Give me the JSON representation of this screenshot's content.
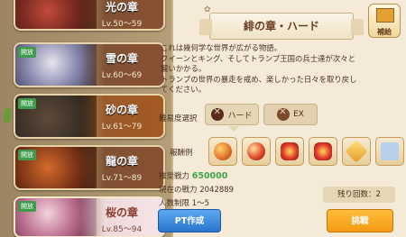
{
  "chapters": [
    {
      "name": "光の章",
      "level": "Lv.50～59",
      "badge": ""
    },
    {
      "name": "雪の章",
      "level": "Lv.60～69",
      "badge": "開放"
    },
    {
      "name": "砂の章",
      "level": "Lv.61～79",
      "badge": "開放"
    },
    {
      "name": "龍の章",
      "level": "Lv.71～89",
      "badge": "開放"
    },
    {
      "name": "桜の章",
      "level": "Lv.85～94",
      "badge": "開放"
    }
  ],
  "panel": {
    "title": "緋の章・ハード",
    "rental_label": "補給",
    "description": [
      "これは幾何学な世界が広がる物語。",
      "クイーンとキング、そしてトランプ王国の兵士達が次々と",
      "襲いかかる。",
      "トランプの世界の暴走を戒め、楽しかった日々を取り戻し",
      "てください。"
    ],
    "difficulty_label": "難易度選択",
    "difficulty_options": [
      "ハード",
      "EX"
    ],
    "difficulty_selected": "ハード",
    "reward_label": "報酬例",
    "rewards": [
      "orb-icon",
      "orb-icon",
      "star-medal-icon",
      "star-medal-icon",
      "crystal-icon",
      "item-icon"
    ],
    "recommended_label": "推奨戦力",
    "recommended_value": "650000",
    "current_label": "現在の戦力",
    "current_value": "2042889",
    "limit_text": "人数制限 1～5",
    "remaining_text": "残り回数：2",
    "pt_button": "PT作成",
    "challenge_button": "挑戦"
  }
}
